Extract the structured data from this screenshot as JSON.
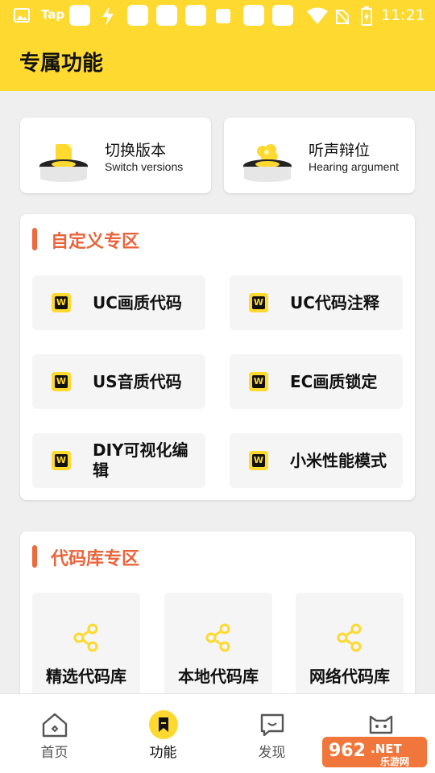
{
  "status_bar": {
    "left_label": "Tap",
    "time": "11:21"
  },
  "header": {
    "title": "专属功能"
  },
  "feature_cards": [
    {
      "title": "切换版本",
      "subtitle": "Switch versions",
      "icon": "yellow-doc-pedestal"
    },
    {
      "title": "听声辩位",
      "subtitle": "Hearing argument",
      "icon": "yellow-flower-pedestal"
    }
  ],
  "custom_section": {
    "title": "自定义专区",
    "items": [
      {
        "label": "UC画质代码",
        "icon": "w-icon"
      },
      {
        "label": "UC代码注释",
        "icon": "w-icon"
      },
      {
        "label": "US音质代码",
        "icon": "w-icon"
      },
      {
        "label": "EC画质锁定",
        "icon": "w-icon"
      },
      {
        "label": "DIY可视化编辑",
        "icon": "w-icon"
      },
      {
        "label": "小米性能模式",
        "icon": "w-icon"
      }
    ],
    "icon_letter": "W"
  },
  "library_section": {
    "title": "代码库专区",
    "items": [
      {
        "label": "精选代码库",
        "icon": "share-icon"
      },
      {
        "label": "本地代码库",
        "icon": "share-icon"
      },
      {
        "label": "网络代码库",
        "icon": "share-icon"
      }
    ]
  },
  "bottom_nav": {
    "items": [
      {
        "label": "首页",
        "icon": "home-icon",
        "active": false
      },
      {
        "label": "功能",
        "icon": "bookmark-icon",
        "active": true
      },
      {
        "label": "发现",
        "icon": "chat-icon",
        "active": false
      },
      {
        "label": "",
        "icon": "cat-icon",
        "active": false
      }
    ]
  },
  "watermark": {
    "brand": "962.NET",
    "text": "乐游网"
  },
  "colors": {
    "accent": "#fed92f",
    "section_title": "#e8643b",
    "section_bar": "#ec6a3f"
  }
}
